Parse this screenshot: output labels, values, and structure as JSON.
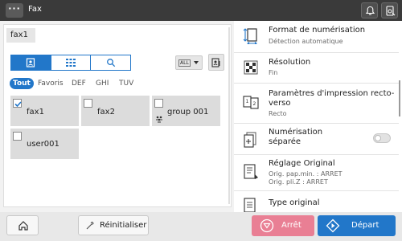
{
  "header": {
    "title": "Fax",
    "menu_label": "···"
  },
  "destination": {
    "value": "fax1"
  },
  "address_book": {
    "filter_dropdown": "ALL",
    "filters": [
      "Tout",
      "Favoris",
      "DEF",
      "GHI",
      "TUV"
    ],
    "entries": [
      {
        "name": "fax1",
        "checked": true
      },
      {
        "name": "fax2",
        "checked": false
      },
      {
        "name": "group 001",
        "checked": false
      },
      {
        "name": "user001",
        "checked": false
      }
    ]
  },
  "settings": [
    {
      "title": "Format de numérisation",
      "subtitle": "Détection automatique"
    },
    {
      "title": "Résolution",
      "subtitle": "Fin"
    },
    {
      "title": "Paramètres d'impression recto-verso",
      "subtitle": "Recto"
    },
    {
      "title": "Numérisation séparée",
      "toggle": "off"
    },
    {
      "title": "Réglage Original",
      "subtitle_1": "Orig. pap.min. : ARRET",
      "subtitle_2": "Orig. pli.Z : ARRET"
    },
    {
      "title": "Type original"
    }
  ],
  "footer": {
    "reset_label": "Réinitialiser",
    "stop_label": "Arrêt",
    "start_label": "Départ"
  },
  "colors": {
    "accent": "#2277c9",
    "stop": "#e97f94",
    "topbar": "#3a3a3a"
  }
}
